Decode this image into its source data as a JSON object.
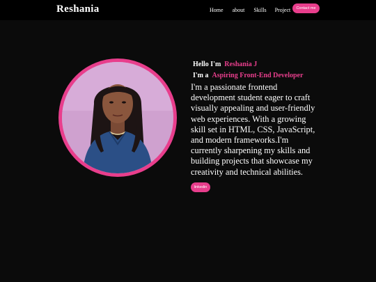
{
  "header": {
    "brand": "Reshania",
    "nav": {
      "home": "Home",
      "about": "about",
      "skills": "Skills",
      "project": "Project"
    },
    "contact_label": "Contact me"
  },
  "hero": {
    "greeting": "Hello I'm",
    "name": "Reshania J",
    "role_prefix": "I'm a",
    "role": "Aspiring Front-End Developer",
    "bio": "I'm a passionate frontend development student eager to craft visually appealing and user-friendly web experiences. With a growing skill set in HTML, CSS, JavaScript, and modern frameworks.I'm currently sharpening my skills and building projects that showcase my creativity and technical abilities.",
    "linkedin_label": "linkedin"
  },
  "colors": {
    "accent": "#e83e8c",
    "background": "#0b0b0b",
    "header_background": "#000000",
    "text": "#ffffff"
  },
  "icons": {
    "profile": "profile-photo"
  }
}
